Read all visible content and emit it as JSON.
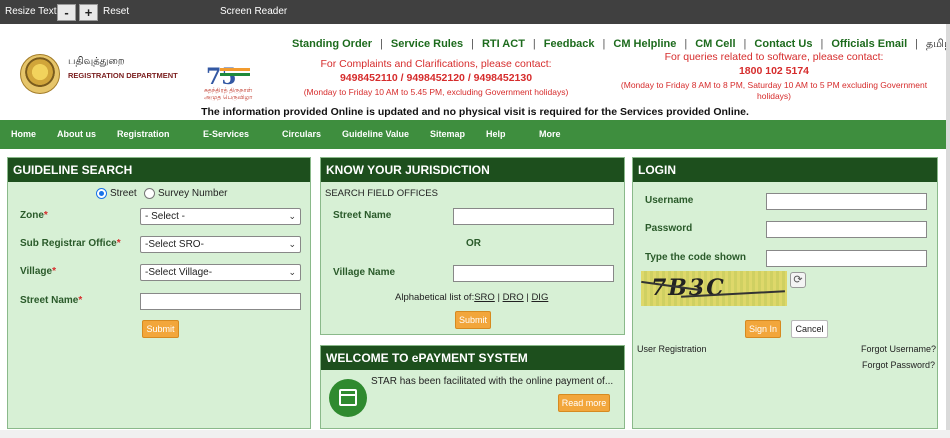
{
  "topbar": {
    "resize_text": "Resize Text",
    "minus": "-",
    "plus": "+",
    "reset": "Reset",
    "screen_reader": "Screen Reader"
  },
  "header": {
    "dept_tamil": "பதிவுத்துறை",
    "dept_english": "REGISTRATION DEPARTMENT",
    "logo75_number": "75",
    "logo75_tamil": "சுதந்திரத் திருநாள் அமுத பெருவிழா",
    "top_links": [
      "Standing Order",
      "Service Rules",
      "RTI ACT",
      "Feedback",
      "CM Helpline",
      "CM Cell",
      "Contact Us",
      "Officials Email",
      "தமிழ்"
    ],
    "complaints": {
      "line1": "For Complaints and Clarifications, please contact:",
      "phones": "9498452110 / 9498452120 / 9498452130",
      "hours": "(Monday to Friday 10 AM to 5.45 PM, excluding Government holidays)"
    },
    "software": {
      "line1": "For queries related to software, please contact:",
      "phone": "1800 102 5174",
      "hours": "(Monday to Friday 8 AM to 8 PM, Saturday 10 AM to 5 PM excluding Government holidays)"
    },
    "notice": "The information provided Online is updated and no physical visit is required for the Services provided Online."
  },
  "nav": {
    "home": "Home",
    "about": "About us",
    "registration": "Registration",
    "eservices": "E-Services",
    "circulars": "Circulars",
    "guideline": "Guideline Value",
    "sitemap": "Sitemap",
    "help": "Help",
    "more": "More"
  },
  "guideline": {
    "title": "GUIDELINE SEARCH",
    "radio_street": "Street",
    "radio_survey": "Survey Number",
    "zone_label": "Zone",
    "zone_value": "- Select -",
    "sro_label": "Sub Registrar Office",
    "sro_value": "-Select SRO-",
    "village_label": "Village",
    "village_value": "-Select Village-",
    "street_label": "Street Name",
    "street_value": "",
    "submit": "Submit"
  },
  "jurisdiction": {
    "title": "KNOW YOUR JURISDICTION",
    "subtitle": "SEARCH FIELD OFFICES",
    "street_label": "Street Name",
    "or": "OR",
    "village_label": "Village Name",
    "alpha_prefix": "Alphabetical list of:",
    "sro": "SRO",
    "dro": "DRO",
    "dig": "DIG",
    "sep": "|",
    "submit": "Submit"
  },
  "epayment": {
    "title": "WELCOME TO ePAYMENT SYSTEM",
    "text": "STAR has been facilitated with the online payment of...",
    "read_more": "Read more"
  },
  "login": {
    "title": "LOGIN",
    "username_label": "Username",
    "password_label": "Password",
    "code_label": "Type the code shown",
    "captcha_text": "7B3C",
    "sign_in": "Sign In",
    "cancel": "Cancel",
    "user_registration": "User Registration",
    "forgot_username": "Forgot Username?",
    "forgot_password": "Forgot Password?"
  }
}
